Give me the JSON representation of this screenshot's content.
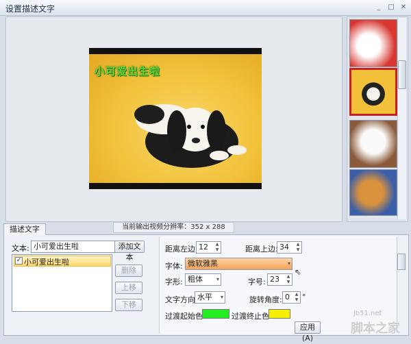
{
  "window": {
    "title": "设置描述文字",
    "controls": [
      "_",
      "□",
      "✕"
    ]
  },
  "preview": {
    "overlay_text": "小可爱出生啦"
  },
  "thumbnails": {
    "selected_index": 1,
    "count": 4
  },
  "bottom": {
    "tab": "描述文字",
    "resolution_info": "当前输出视频分辨率：352 x 288",
    "left": {
      "text_label": "文本:",
      "text_value": "小可爱出生啦",
      "add_button": "添加文本",
      "list_items": [
        "小可爱出生啦"
      ],
      "delete_button": "删除",
      "up_button": "上移",
      "down_button": "下移"
    },
    "right": {
      "left_margin_label": "距离左边:",
      "left_margin_value": "12",
      "top_margin_label": "距离上边:",
      "top_margin_value": "34",
      "font_label": "字体:",
      "font_value": "微软雅黑",
      "style_label": "字形:",
      "style_value": "粗体",
      "size_label": "字号:",
      "size_value": "23",
      "direction_label": "文字方向:",
      "direction_value": "水平",
      "rotation_label": "旋转角度:",
      "rotation_value": "0",
      "rotation_unit": "°",
      "gradient_start_label": "过渡起始色:",
      "gradient_start_color": "#22ee22",
      "gradient_end_label": "过渡终止色:",
      "gradient_end_color": "#f4f000"
    },
    "apply_button": "应用(A)"
  },
  "watermark": {
    "site": "jb51.net",
    "name": "脚本之家"
  }
}
